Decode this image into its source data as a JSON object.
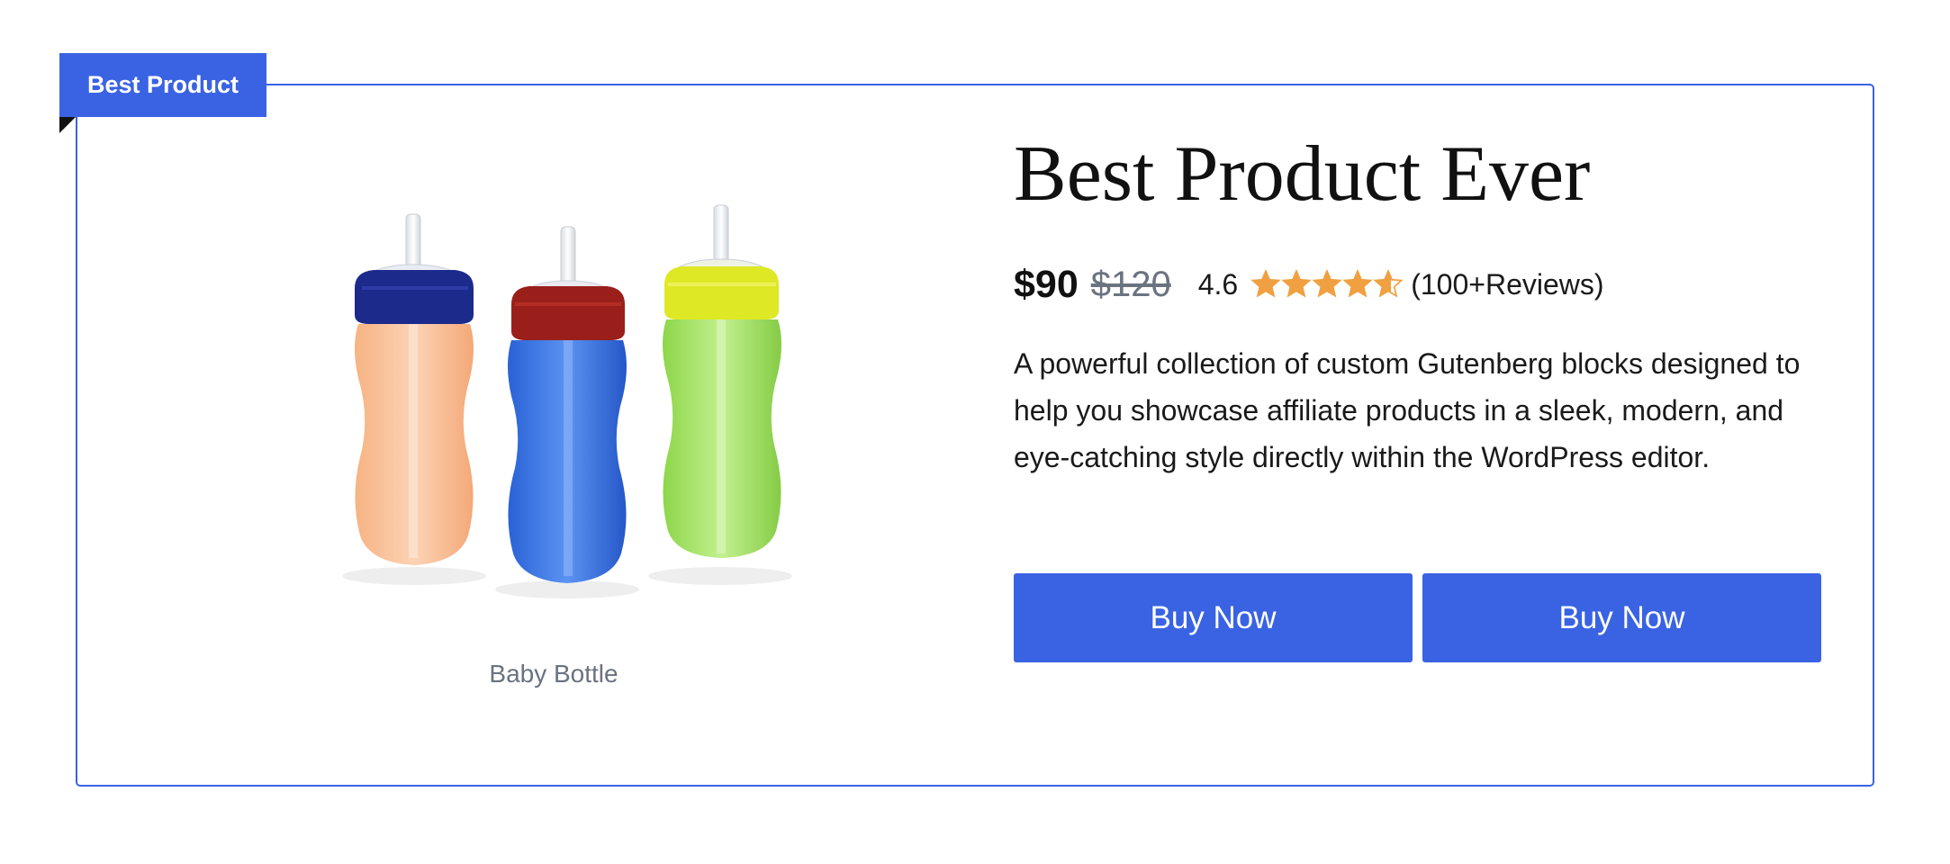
{
  "badge": {
    "label": "Best Product"
  },
  "product": {
    "title": "Best Product Ever",
    "image_caption": "Baby Bottle",
    "price_current": "$90",
    "price_original": "$120",
    "rating_value": "4.6",
    "rating_stars": 4.6,
    "rating_max": 5,
    "reviews_label": "(100+Reviews)",
    "description": "A powerful collection of custom Gutenberg blocks designed to help you showcase affiliate products in a sleek, modern, and eye-catching style directly within the WordPress editor."
  },
  "buttons": {
    "primary_label": "Buy Now",
    "secondary_label": "Buy Now"
  },
  "icons": {
    "star": "star-icon",
    "image": "baby-bottles-image"
  },
  "colors": {
    "accent": "#3a63e3",
    "star": "#f0a040",
    "muted_text": "#6b7280"
  }
}
